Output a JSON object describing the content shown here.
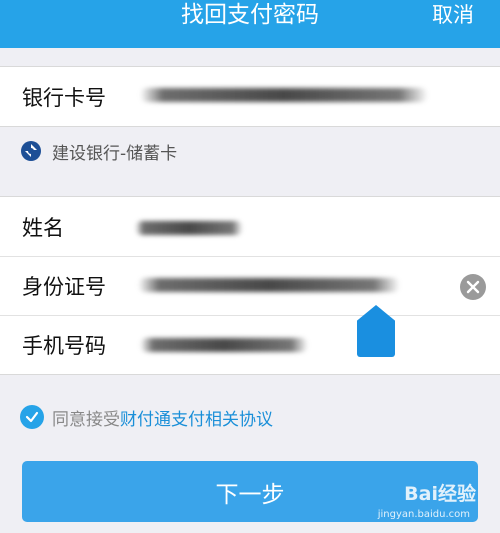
{
  "header": {
    "title": "找回支付密码",
    "cancel_label": "取消"
  },
  "card": {
    "label": "银行卡号",
    "bank_name": "建设银行-储蓄卡",
    "bank_icon": "ccb-bank-icon"
  },
  "form": {
    "name_label": "姓名",
    "id_label": "身份证号",
    "phone_label": "手机号码"
  },
  "agreement": {
    "prefix": "同意接受",
    "link": "财付通支付相关协议",
    "checked": true
  },
  "next_button": "下一步",
  "watermark": {
    "brand": "Bai经验",
    "url": "jingyan.baidu.com"
  },
  "colors": {
    "accent": "#26a3e8",
    "button": "#3aa4ea",
    "background": "#efeff4"
  }
}
